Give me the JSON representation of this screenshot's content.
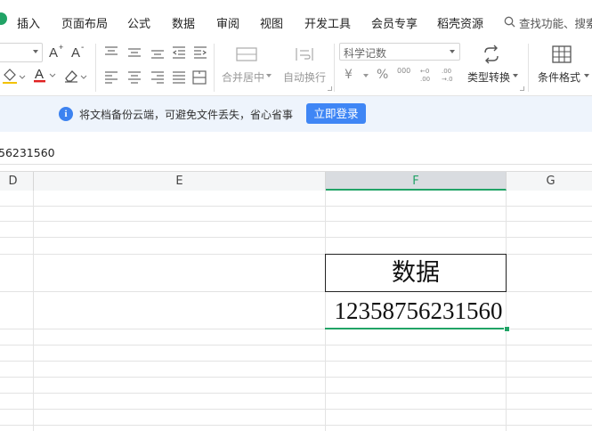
{
  "menu": {
    "items": [
      "插入",
      "页面布局",
      "公式",
      "数据",
      "审阅",
      "视图",
      "开发工具",
      "会员专享",
      "稻壳资源"
    ],
    "search_placeholder": "查找功能、搜索"
  },
  "ribbon": {
    "merge_label": "合并居中",
    "wrap_label": "自动换行",
    "number_format_value": "科学记数",
    "currency_symbol": "¥",
    "percent_symbol": "%",
    "thousands_symbol": "000",
    "type_convert_label": "类型转换",
    "conditional_format_label": "条件格式"
  },
  "notice": {
    "text": "将文档备份云端，可避免文件丢失，省心省事",
    "button_label": "立即登录"
  },
  "formula_bar": {
    "value": "56231560"
  },
  "columns": [
    {
      "label": "D",
      "selected": false
    },
    {
      "label": "E",
      "selected": false
    },
    {
      "label": "F",
      "selected": true
    },
    {
      "label": "G",
      "selected": false
    }
  ],
  "cells": {
    "header_cell": "数据",
    "value_cell": "12358756231560"
  },
  "colors": {
    "accent_green": "#21a366",
    "button_blue": "#3f86f5",
    "font_red": "#e02020",
    "info_blue": "#3c82f0"
  }
}
